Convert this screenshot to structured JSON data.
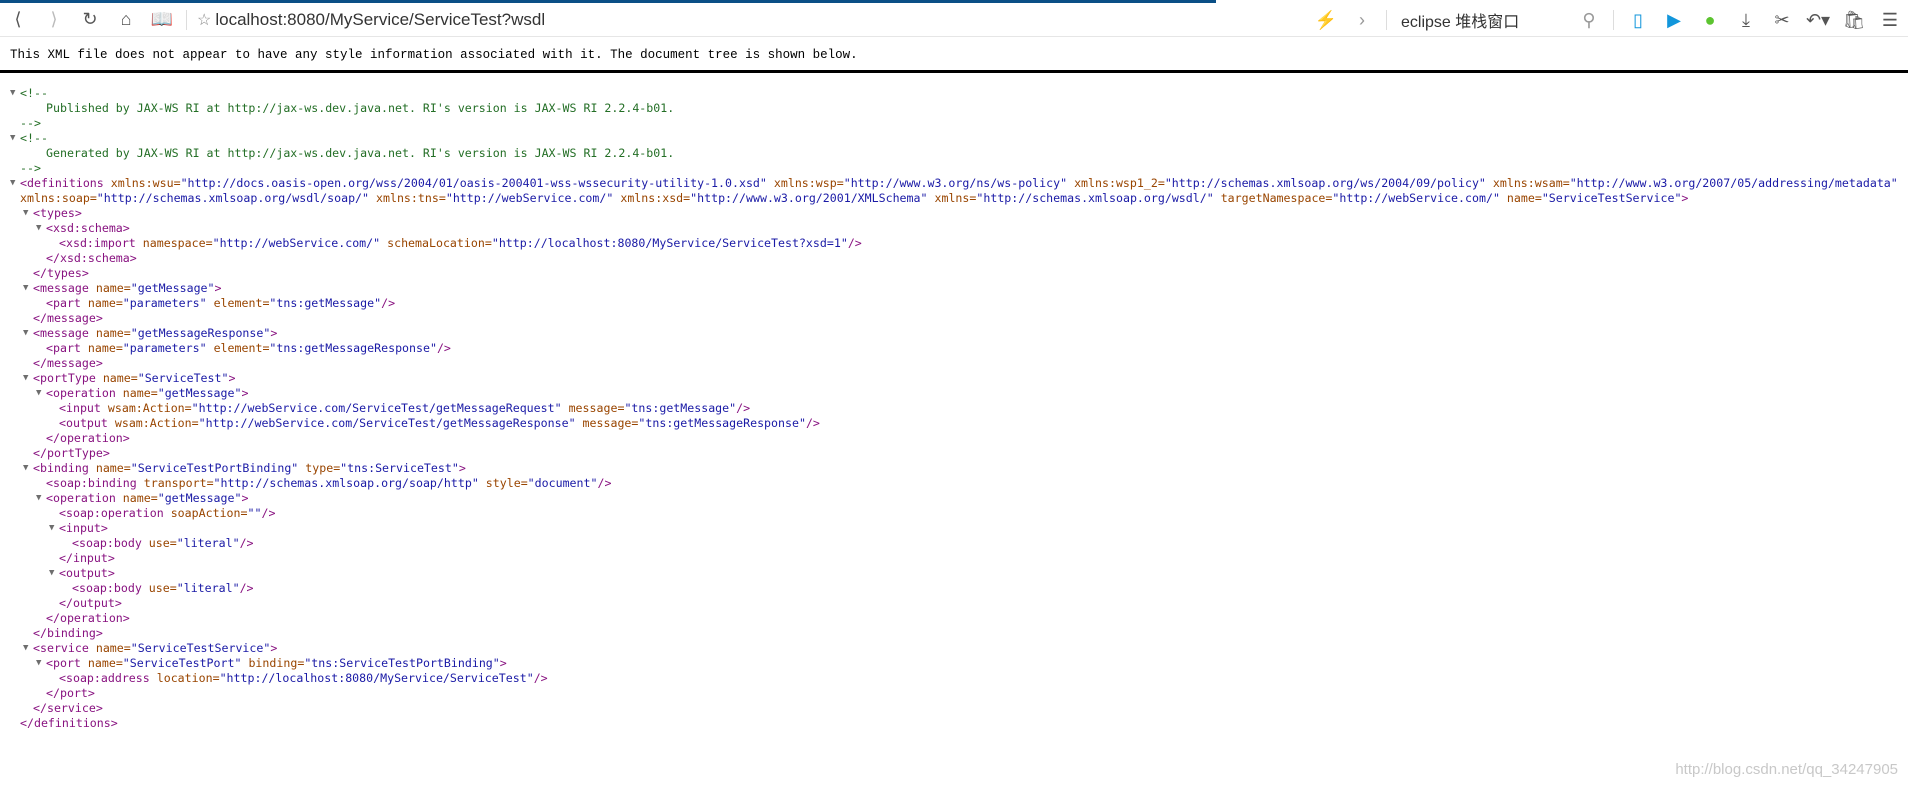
{
  "browser": {
    "url": "localhost:8080/MyService/ServiceTest?wsdl",
    "search_value": "eclipse 堆栈窗口",
    "icons": [
      "back-icon",
      "forward-icon",
      "reload-icon",
      "home-icon",
      "reader-icon",
      "star-icon",
      "flash-icon",
      "chevron-right-icon",
      "search-icon",
      "phone-icon",
      "play-icon",
      "wechat-icon",
      "download-icon",
      "scissors-icon",
      "undo-icon",
      "bag-icon",
      "menu-icon"
    ]
  },
  "notice": "This XML file does not appear to have any style information associated with it. The document tree is shown below.",
  "colors": {
    "tag": "#881280",
    "attr_name": "#994500",
    "attr_value": "#1a1aa6",
    "comment": "#236e25"
  },
  "xml": {
    "lines": [
      {
        "d": 0,
        "k": "copen",
        "text": "<!--"
      },
      {
        "d": 2,
        "k": "ctext",
        "text": "Published by JAX-WS RI at http://jax-ws.dev.java.net. RI's version is JAX-WS RI 2.2.4-b01."
      },
      {
        "d": 0,
        "k": "ctext",
        "text": "-->"
      },
      {
        "d": 0,
        "k": "copen",
        "text": "<!--"
      },
      {
        "d": 2,
        "k": "ctext",
        "text": "Generated by JAX-WS RI at http://jax-ws.dev.java.net. RI's version is JAX-WS RI 2.2.4-b01."
      },
      {
        "d": 0,
        "k": "ctext",
        "text": "-->"
      },
      {
        "d": 0,
        "k": "open",
        "tag": "definitions",
        "a": [
          [
            "xmlns:wsu",
            "http://docs.oasis-open.org/wss/2004/01/oasis-200401-wss-wssecurity-utility-1.0.xsd"
          ],
          [
            "xmlns:wsp",
            "http://www.w3.org/ns/ws-policy"
          ],
          [
            "xmlns:wsp1_2",
            "http://schemas.xmlsoap.org/ws/2004/09/policy"
          ],
          [
            "xmlns:wsam",
            "http://www.w3.org/2007/05/addressing/metadata"
          ],
          [
            "xmlns:soap",
            "http://schemas.xmlsoap.org/wsdl/soap/"
          ],
          [
            "xmlns:tns",
            "http://webService.com/"
          ],
          [
            "xmlns:xsd",
            "http://www.w3.org/2001/XMLSchema"
          ],
          [
            "xmlns",
            "http://schemas.xmlsoap.org/wsdl/"
          ],
          [
            "targetNamespace",
            "http://webService.com/"
          ],
          [
            "name",
            "ServiceTestService"
          ]
        ]
      },
      {
        "d": 1,
        "k": "open",
        "tag": "types",
        "a": []
      },
      {
        "d": 2,
        "k": "open",
        "tag": "xsd:schema",
        "a": []
      },
      {
        "d": 3,
        "k": "self",
        "tag": "xsd:import",
        "a": [
          [
            "namespace",
            "http://webService.com/"
          ],
          [
            "schemaLocation",
            "http://localhost:8080/MyService/ServiceTest?xsd=1"
          ]
        ]
      },
      {
        "d": 2,
        "k": "close",
        "tag": "xsd:schema"
      },
      {
        "d": 1,
        "k": "close",
        "tag": "types"
      },
      {
        "d": 1,
        "k": "open",
        "tag": "message",
        "a": [
          [
            "name",
            "getMessage"
          ]
        ]
      },
      {
        "d": 2,
        "k": "self",
        "tag": "part",
        "a": [
          [
            "name",
            "parameters"
          ],
          [
            "element",
            "tns:getMessage"
          ]
        ]
      },
      {
        "d": 1,
        "k": "close",
        "tag": "message"
      },
      {
        "d": 1,
        "k": "open",
        "tag": "message",
        "a": [
          [
            "name",
            "getMessageResponse"
          ]
        ]
      },
      {
        "d": 2,
        "k": "self",
        "tag": "part",
        "a": [
          [
            "name",
            "parameters"
          ],
          [
            "element",
            "tns:getMessageResponse"
          ]
        ]
      },
      {
        "d": 1,
        "k": "close",
        "tag": "message"
      },
      {
        "d": 1,
        "k": "open",
        "tag": "portType",
        "a": [
          [
            "name",
            "ServiceTest"
          ]
        ]
      },
      {
        "d": 2,
        "k": "open",
        "tag": "operation",
        "a": [
          [
            "name",
            "getMessage"
          ]
        ]
      },
      {
        "d": 3,
        "k": "self",
        "tag": "input",
        "a": [
          [
            "wsam:Action",
            "http://webService.com/ServiceTest/getMessageRequest"
          ],
          [
            "message",
            "tns:getMessage"
          ]
        ]
      },
      {
        "d": 3,
        "k": "self",
        "tag": "output",
        "a": [
          [
            "wsam:Action",
            "http://webService.com/ServiceTest/getMessageResponse"
          ],
          [
            "message",
            "tns:getMessageResponse"
          ]
        ]
      },
      {
        "d": 2,
        "k": "close",
        "tag": "operation"
      },
      {
        "d": 1,
        "k": "close",
        "tag": "portType"
      },
      {
        "d": 1,
        "k": "open",
        "tag": "binding",
        "a": [
          [
            "name",
            "ServiceTestPortBinding"
          ],
          [
            "type",
            "tns:ServiceTest"
          ]
        ]
      },
      {
        "d": 2,
        "k": "self",
        "tag": "soap:binding",
        "a": [
          [
            "transport",
            "http://schemas.xmlsoap.org/soap/http"
          ],
          [
            "style",
            "document"
          ]
        ]
      },
      {
        "d": 2,
        "k": "open",
        "tag": "operation",
        "a": [
          [
            "name",
            "getMessage"
          ]
        ]
      },
      {
        "d": 3,
        "k": "self",
        "tag": "soap:operation",
        "a": [
          [
            "soapAction",
            ""
          ]
        ]
      },
      {
        "d": 3,
        "k": "open",
        "tag": "input",
        "a": []
      },
      {
        "d": 4,
        "k": "self",
        "tag": "soap:body",
        "a": [
          [
            "use",
            "literal"
          ]
        ]
      },
      {
        "d": 3,
        "k": "close",
        "tag": "input"
      },
      {
        "d": 3,
        "k": "open",
        "tag": "output",
        "a": []
      },
      {
        "d": 4,
        "k": "self",
        "tag": "soap:body",
        "a": [
          [
            "use",
            "literal"
          ]
        ]
      },
      {
        "d": 3,
        "k": "close",
        "tag": "output"
      },
      {
        "d": 2,
        "k": "close",
        "tag": "operation"
      },
      {
        "d": 1,
        "k": "close",
        "tag": "binding"
      },
      {
        "d": 1,
        "k": "open",
        "tag": "service",
        "a": [
          [
            "name",
            "ServiceTestService"
          ]
        ]
      },
      {
        "d": 2,
        "k": "open",
        "tag": "port",
        "a": [
          [
            "name",
            "ServiceTestPort"
          ],
          [
            "binding",
            "tns:ServiceTestPortBinding"
          ]
        ]
      },
      {
        "d": 3,
        "k": "self",
        "tag": "soap:address",
        "a": [
          [
            "location",
            "http://localhost:8080/MyService/ServiceTest"
          ]
        ]
      },
      {
        "d": 2,
        "k": "close",
        "tag": "port"
      },
      {
        "d": 1,
        "k": "close",
        "tag": "service"
      },
      {
        "d": 0,
        "k": "close",
        "tag": "definitions"
      }
    ]
  },
  "watermark": "http://blog.csdn.net/qq_34247905"
}
